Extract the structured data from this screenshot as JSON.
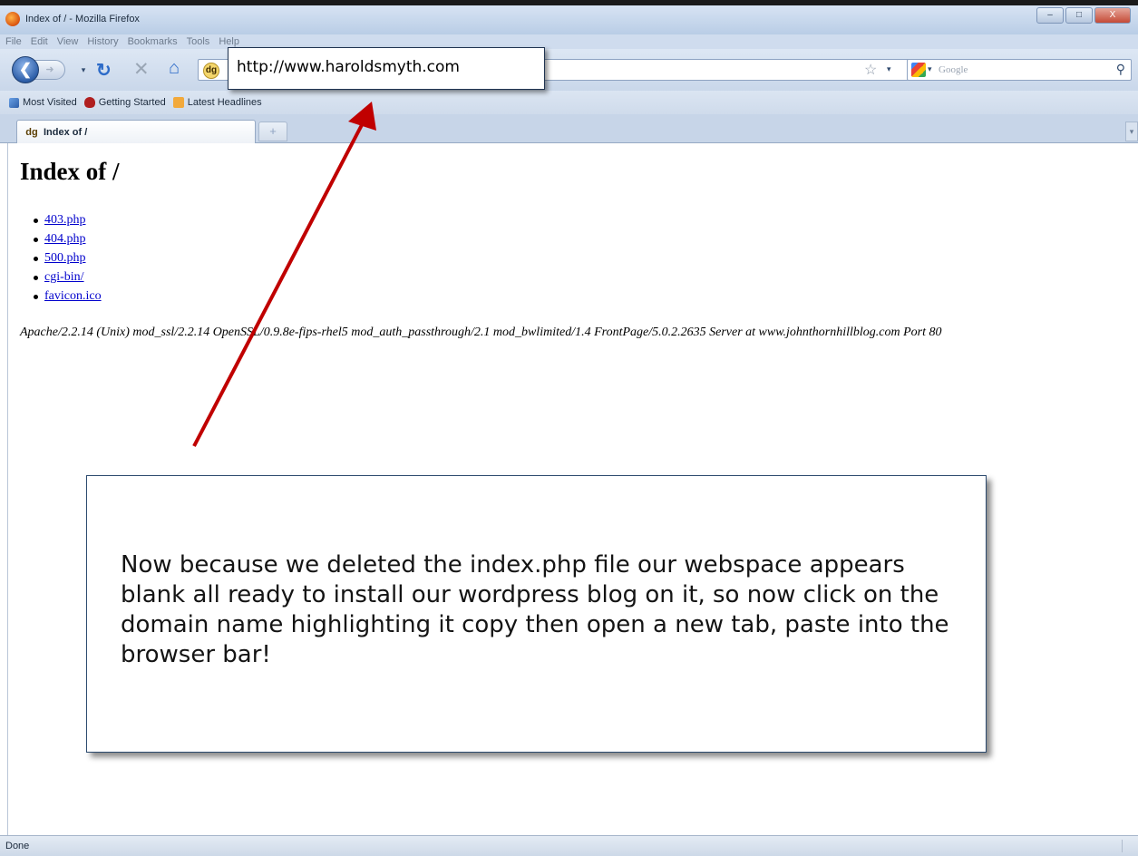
{
  "window": {
    "title": "Index of / - Mozilla Firefox",
    "controls": {
      "minimize": "–",
      "maximize": "□",
      "close": "X"
    }
  },
  "menu": [
    "File",
    "Edit",
    "View",
    "History",
    "Bookmarks",
    "Tools",
    "Help"
  ],
  "nav": {
    "search_placeholder": "Google",
    "site_icon_glyph": "dg",
    "icons": [
      "back-arrow-icon",
      "forward-arrow-icon",
      "reload-icon",
      "stop-icon",
      "home-icon",
      "bookmark-star-icon",
      "google-icon",
      "search-icon"
    ]
  },
  "bookmarks": [
    "Most Visited",
    "Getting Started",
    "Latest Headlines"
  ],
  "tab": {
    "label": "Index of /",
    "new_tab": "+"
  },
  "page": {
    "heading": "Index of /",
    "links": [
      "403.php",
      "404.php",
      "500.php",
      "cgi-bin/",
      "favicon.ico"
    ],
    "server_signature": "Apache/2.2.14 (Unix) mod_ssl/2.2.14 OpenSSL/0.9.8e-fips-rhel5 mod_auth_passthrough/2.1 mod_bwlimited/1.4 FrontPage/5.0.2.2635 Server at www.johnthornhillblog.com Port 80"
  },
  "callout": {
    "url": "http://www.haroldsmyth.com",
    "note": "Now because we deleted the index.php file our webspace appears blank all ready to install our wordpress blog on it, so now click on the domain name highlighting it copy then open a new tab, paste into the browser bar!"
  },
  "status": "Done",
  "colors": {
    "arrow": "#c00000",
    "link": "#0000cc",
    "chrome": "#c9d7ea"
  }
}
